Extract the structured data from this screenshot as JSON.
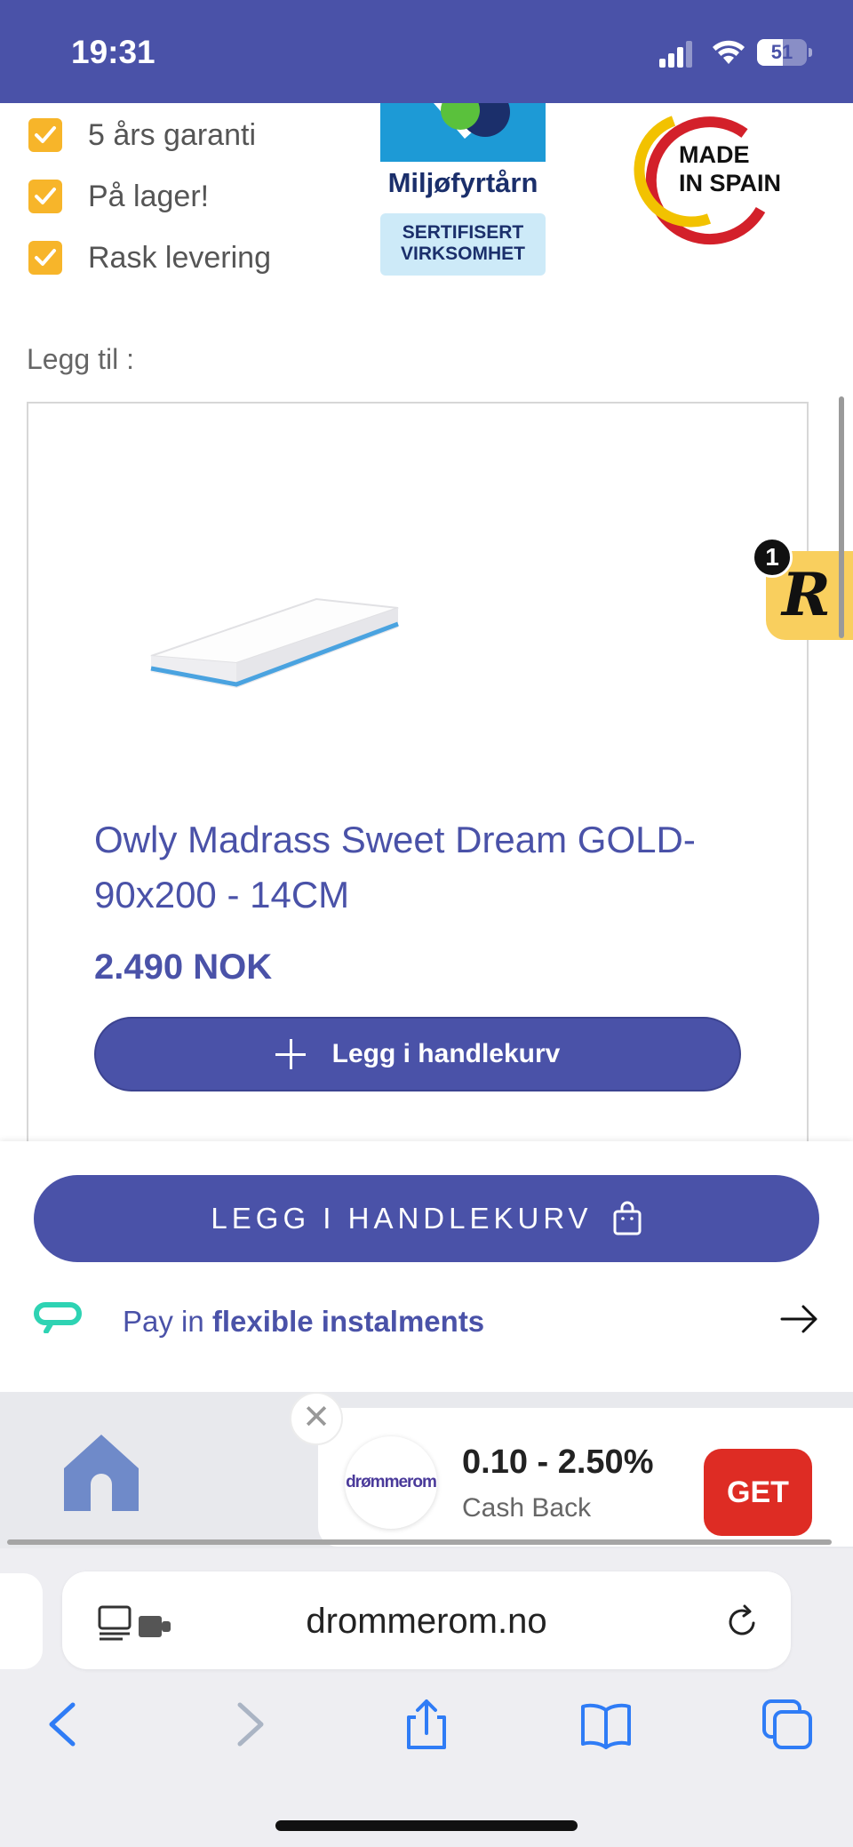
{
  "status_bar": {
    "time": "19:31",
    "battery_level": "51",
    "battery_fraction": 0.51
  },
  "features": [
    "5 års garanti",
    "På lager!",
    "Rask levering"
  ],
  "badges": {
    "miljo_name": "Miljøfyrtårn",
    "miljo_cert_line1": "SERTIFISERT",
    "miljo_cert_line2": "VIRKSOMHET",
    "spain_line1": "MADE",
    "spain_line2": "IN SPAIN"
  },
  "addon_label": "Legg til :",
  "product": {
    "title": "Owly Madrass Sweet Dream GOLD-90x200 - 14CM",
    "price": "2.490 NOK",
    "add_button": "Legg i handlekurv"
  },
  "floating_widget": {
    "letter": "R",
    "badge_count": "1"
  },
  "sticky": {
    "add_button": "LEGG I HANDLEKURV",
    "pay_prefix": "Pay in",
    "pay_bold": "flexible instalments"
  },
  "cashback": {
    "close": "✕",
    "logo_text": "drømmerom",
    "rate": "0.10 - 2.50%",
    "sub": "Cash Back",
    "get_label": "GET"
  },
  "browser": {
    "url": "drommerom.no"
  },
  "colors": {
    "brand": "#4a52a8",
    "check": "#f7b52a",
    "get_button": "#de2c24",
    "ios_blue": "#2f7cf6"
  }
}
